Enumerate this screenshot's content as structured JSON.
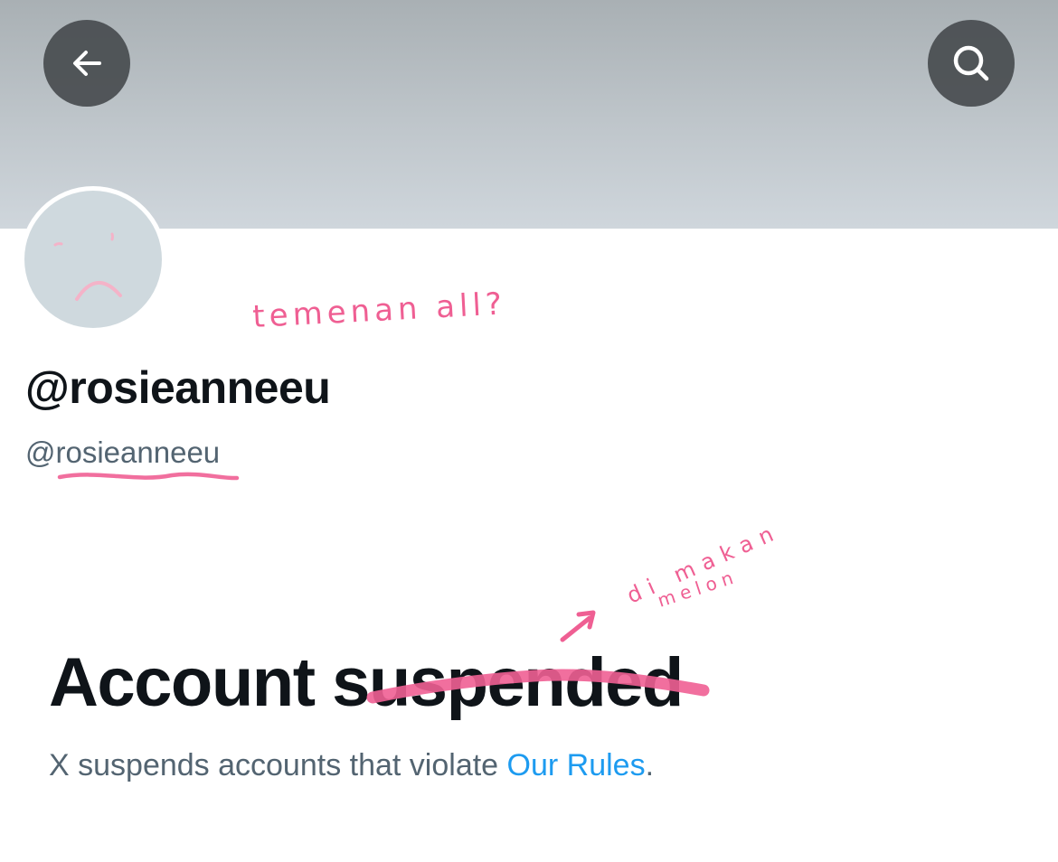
{
  "header": {
    "back_icon": "arrow-left-icon",
    "search_icon": "search-icon",
    "banner_color": "#c3cace",
    "button_color": "#484c4f"
  },
  "profile": {
    "display_name": "@rosieanneeu",
    "handle": "@rosieanneeu",
    "avatar_color": "#cfd9de"
  },
  "notice": {
    "title": "Account suspended",
    "description_prefix": "X suspends accounts that violate ",
    "link_text": "Our Rules",
    "description_suffix": ".",
    "link_color": "#1d9bf0"
  },
  "annotations": {
    "note_1": "temenan all?",
    "note_2_line1": "di makan",
    "note_2_line2": "melon",
    "ink_color": "#ef5f93"
  }
}
